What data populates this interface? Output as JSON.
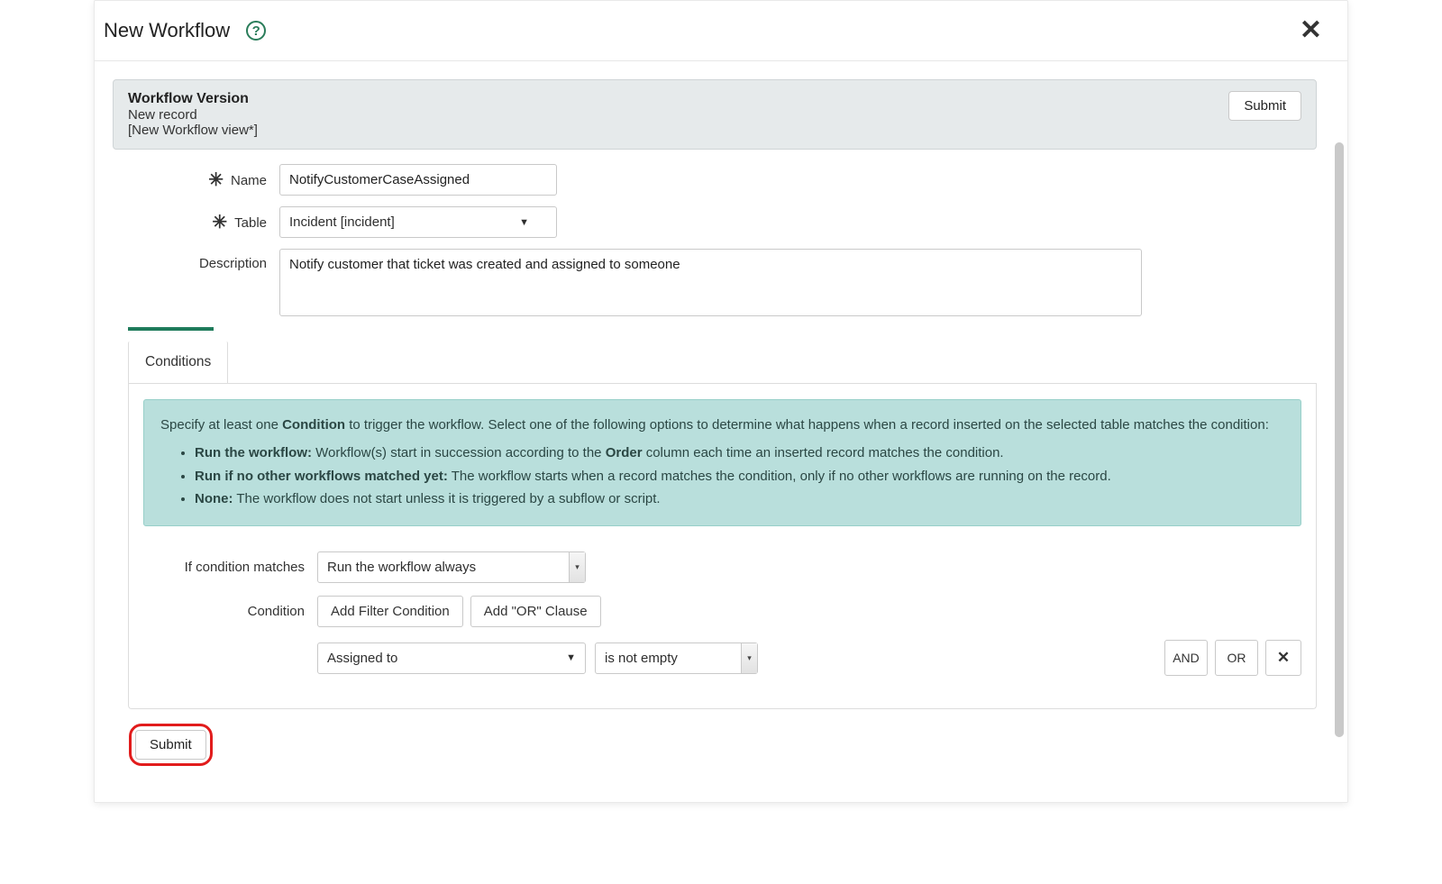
{
  "modal": {
    "title": "New Workflow",
    "help_alt": "?"
  },
  "record_header": {
    "title": "Workflow Version",
    "status": "New record",
    "view": "[New Workflow view*]",
    "submit_label": "Submit"
  },
  "form": {
    "name_label": "Name",
    "name_value": "NotifyCustomerCaseAssigned",
    "table_label": "Table",
    "table_value": "Incident [incident]",
    "description_label": "Description",
    "description_value": "Notify customer that ticket was created and assigned to someone"
  },
  "tabs": {
    "conditions": "Conditions"
  },
  "info_box": {
    "intro_pre": "Specify at least one ",
    "intro_strong1": "Condition",
    "intro_mid": " to trigger the workflow. Select one of the following options to determine what happens when a record inserted on the selected table matches the condition:",
    "li1_strong": "Run the workflow:",
    "li1_text_a": " Workflow(s) start in succession according to the ",
    "li1_strong2": "Order",
    "li1_text_b": " column each time an inserted record matches the condition.",
    "li2_strong": "Run if no other workflows matched yet:",
    "li2_text": " The workflow starts when a record matches the condition, only if no other workflows are running on the record.",
    "li3_strong": "None:",
    "li3_text": " The workflow does not start unless it is triggered by a subflow or script."
  },
  "conditions": {
    "if_matches_label": "If condition matches",
    "if_matches_value": "Run the workflow always",
    "condition_label": "Condition",
    "add_filter_label": "Add Filter Condition",
    "add_or_label": "Add \"OR\" Clause",
    "field_value": "Assigned to",
    "operator_value": "is not empty",
    "and_label": "AND",
    "or_label": "OR"
  },
  "footer": {
    "submit_label": "Submit"
  }
}
